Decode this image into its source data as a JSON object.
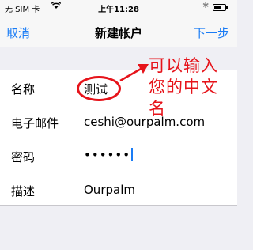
{
  "status_bar": {
    "carrier": "无 SIM 卡",
    "time": "上午11:28",
    "battery_level": 0.6
  },
  "nav": {
    "cancel": "取消",
    "title": "新建帐户",
    "next": "下一步"
  },
  "form": {
    "name_label": "名称",
    "name_value": "测试",
    "email_label": "电子邮件",
    "email_value": "ceshi@ourpalm.com",
    "password_label": "密码",
    "password_value": "••••••",
    "description_label": "描述",
    "description_value": "Ourpalm"
  },
  "annotation": {
    "text": "可以输入您的中文名",
    "color": "#e6131a"
  },
  "colors": {
    "accent": "#1a7cf5",
    "background": "#efeff4"
  }
}
